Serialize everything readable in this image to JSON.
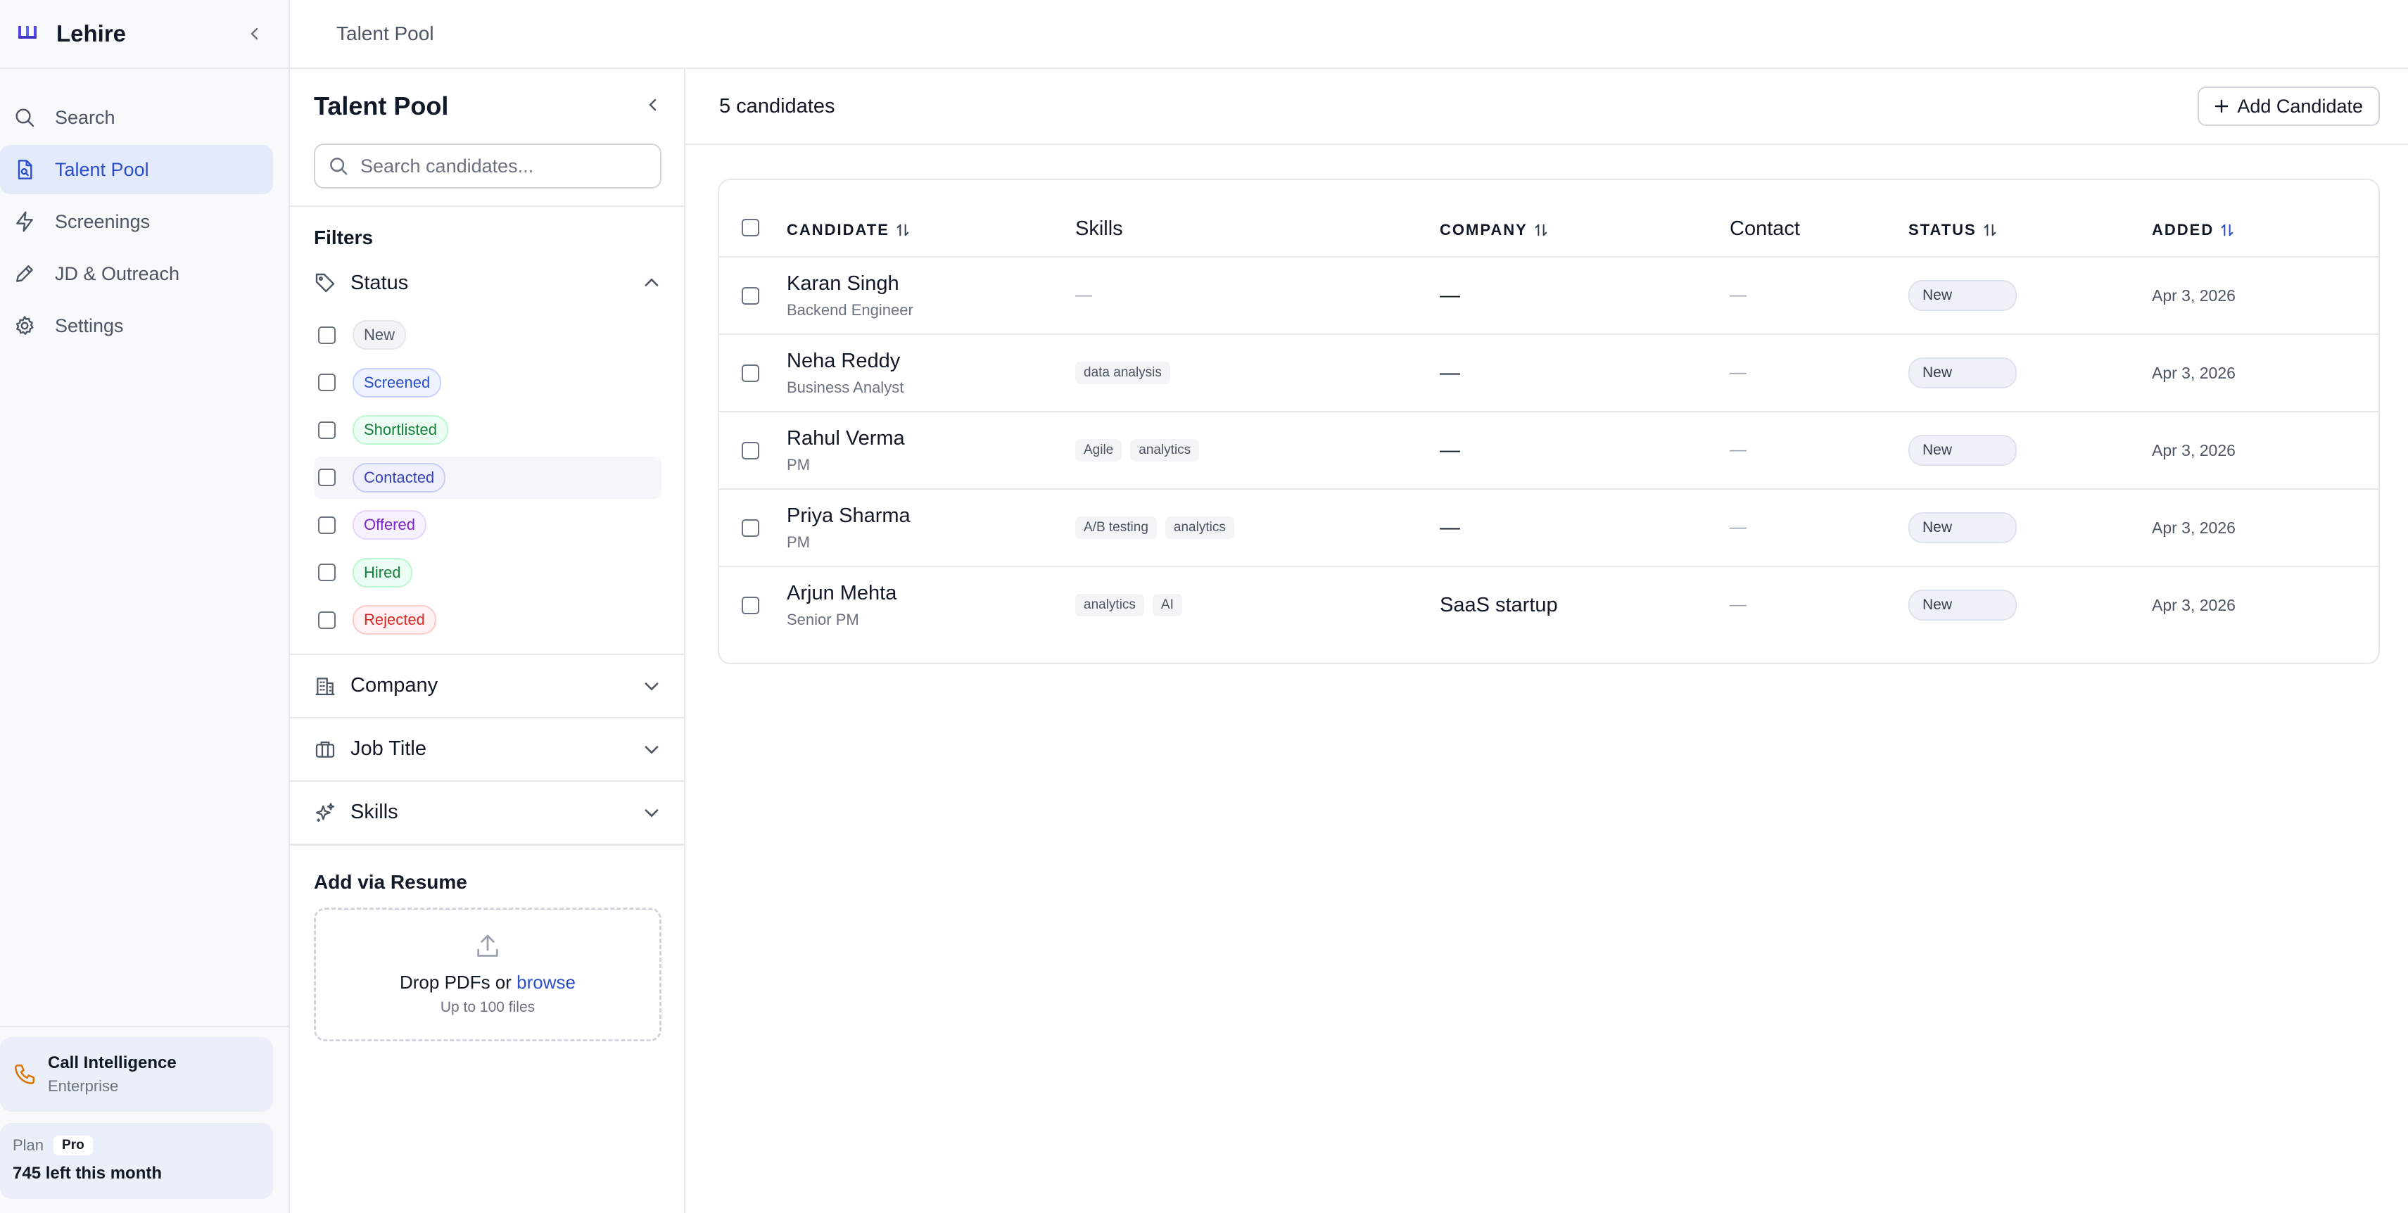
{
  "app": {
    "name": "Lehire",
    "breadcrumb": "Talent Pool"
  },
  "colors": {
    "accent": "#2b4fc9",
    "active_nav_bg": "#e3eafa",
    "sidebar_bg": "#f8f9fb"
  },
  "nav": {
    "items": [
      {
        "label": "Search",
        "icon": "search-icon"
      },
      {
        "label": "Talent Pool",
        "icon": "document-search-icon",
        "active": true
      },
      {
        "label": "Screenings",
        "icon": "lightning-icon"
      },
      {
        "label": "JD & Outreach",
        "icon": "pen-icon"
      },
      {
        "label": "Settings",
        "icon": "gear-icon"
      }
    ],
    "call_intelligence": {
      "title": "Call Intelligence",
      "subtitle": "Enterprise",
      "icon": "phone-icon"
    },
    "plan": {
      "label": "Plan",
      "badge": "Pro",
      "remaining": "745 left this month"
    }
  },
  "filters": {
    "title": "Talent Pool",
    "search_placeholder": "Search candidates...",
    "label": "Filters",
    "status": {
      "label": "Status",
      "options": [
        {
          "label": "New",
          "color": "#4b5563",
          "bg": "#f3f4f6",
          "border": "#e5e7eb"
        },
        {
          "label": "Screened",
          "color": "#2b4fc9",
          "bg": "#eef2ff",
          "border": "#c7d2fe"
        },
        {
          "label": "Shortlisted",
          "color": "#15803d",
          "bg": "#ecfdf3",
          "border": "#bbf7d0"
        },
        {
          "label": "Contacted",
          "color": "#3b3fb6",
          "bg": "#eef0fc",
          "border": "#c7cdf5"
        },
        {
          "label": "Offered",
          "color": "#7e22ce",
          "bg": "#f7f0fe",
          "border": "#e9d5ff"
        },
        {
          "label": "Hired",
          "color": "#15803d",
          "bg": "#ecfdf3",
          "border": "#bbf7d0"
        },
        {
          "label": "Rejected",
          "color": "#dc2626",
          "bg": "#fef2f2",
          "border": "#fecaca"
        }
      ]
    },
    "sections": [
      {
        "label": "Company",
        "icon": "building-icon"
      },
      {
        "label": "Job Title",
        "icon": "briefcase-icon"
      },
      {
        "label": "Skills",
        "icon": "sparkles-icon"
      }
    ],
    "resume": {
      "title": "Add via Resume",
      "drop_text": "Drop PDFs or ",
      "browse": "browse",
      "limit": "Up to 100 files"
    }
  },
  "main": {
    "count": "5 candidates",
    "add_button": "Add Candidate",
    "columns": {
      "candidate": "CANDIDATE",
      "skills": "Skills",
      "company": "COMPANY",
      "contact": "Contact",
      "status": "STATUS",
      "added": "ADDED"
    },
    "rows": [
      {
        "name": "Karan Singh",
        "title": "Backend Engineer",
        "skills": [],
        "company": "",
        "contact": "—",
        "status": "New",
        "added": "Apr 3, 2026"
      },
      {
        "name": "Neha Reddy",
        "title": "Business Analyst",
        "skills": [
          "data analysis"
        ],
        "company": "",
        "contact": "—",
        "status": "New",
        "added": "Apr 3, 2026"
      },
      {
        "name": "Rahul Verma",
        "title": "PM",
        "skills": [
          "Agile",
          "analytics"
        ],
        "company": "",
        "contact": "—",
        "status": "New",
        "added": "Apr 3, 2026"
      },
      {
        "name": "Priya Sharma",
        "title": "PM",
        "skills": [
          "A/B testing",
          "analytics"
        ],
        "company": "",
        "contact": "—",
        "status": "New",
        "added": "Apr 3, 2026"
      },
      {
        "name": "Arjun Mehta",
        "title": "Senior PM",
        "skills": [
          "analytics",
          "AI"
        ],
        "company": "SaaS startup",
        "contact": "—",
        "status": "New",
        "added": "Apr 3, 2026"
      }
    ],
    "empty_skills": "—",
    "empty_company": "—"
  }
}
